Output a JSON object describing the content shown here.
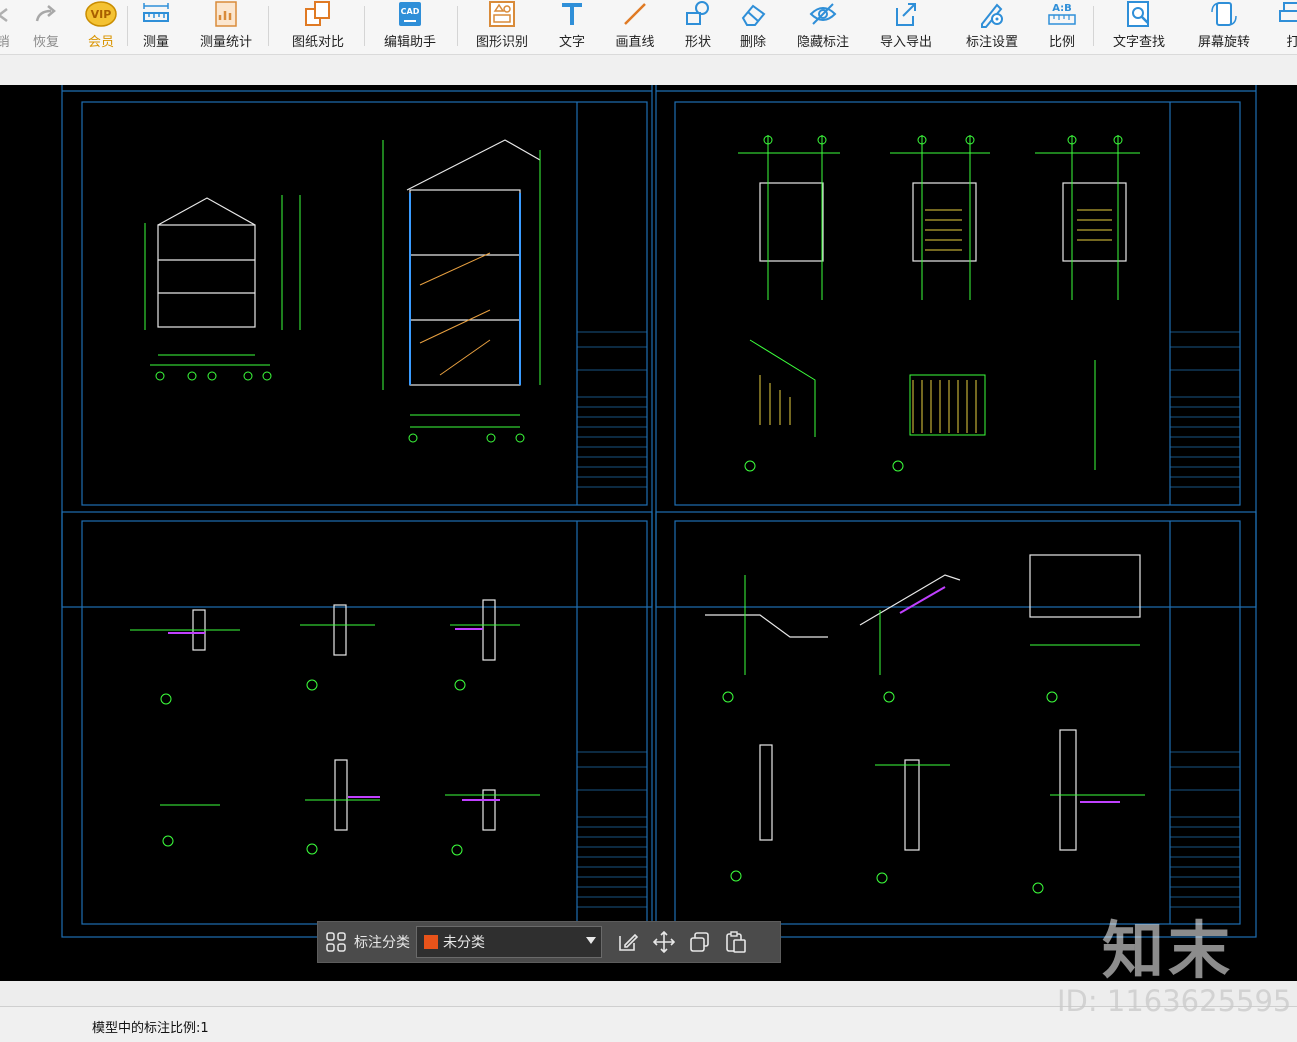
{
  "toolbar": {
    "items": [
      {
        "label": "销",
        "icon": "undo-icon"
      },
      {
        "label": "恢复",
        "icon": "redo-icon"
      },
      {
        "label": "会员",
        "icon": "vip-icon"
      },
      {
        "label": "测量",
        "icon": "measure-icon"
      },
      {
        "label": "测量统计",
        "icon": "measure-stats-icon"
      },
      {
        "label": "图纸对比",
        "icon": "compare-icon"
      },
      {
        "label": "编辑助手",
        "icon": "cad-edit-icon"
      },
      {
        "label": "图形识别",
        "icon": "shape-recognize-icon"
      },
      {
        "label": "文字",
        "icon": "text-icon"
      },
      {
        "label": "画直线",
        "icon": "line-icon"
      },
      {
        "label": "形状",
        "icon": "shape-icon"
      },
      {
        "label": "删除",
        "icon": "eraser-icon"
      },
      {
        "label": "隐藏标注",
        "icon": "hide-eye-icon"
      },
      {
        "label": "导入导出",
        "icon": "import-export-icon"
      },
      {
        "label": "标注设置",
        "icon": "annotation-settings-icon"
      },
      {
        "label": "比例",
        "icon": "scale-icon"
      },
      {
        "label": "文字查找",
        "icon": "text-search-icon"
      },
      {
        "label": "屏幕旋转",
        "icon": "rotate-screen-icon"
      },
      {
        "label": "打",
        "icon": "print-icon"
      }
    ],
    "vip_badge": "VIP",
    "ratio_text": "A:B",
    "cad_text": "CAD"
  },
  "annotation_bar": {
    "label": "标注分类",
    "selected": "未分类",
    "swatch_color": "#e8531a"
  },
  "status": {
    "text": "模型中的标注比例:1"
  },
  "watermark": {
    "brand": "知末",
    "id": "ID: 1163625595"
  },
  "colors": {
    "accent_vip": "#d99400",
    "icon_blue": "#2f8fd8",
    "cad_background": "#000000",
    "cad_frame": "#1f6fb2",
    "cad_line_green": "#3cff3c"
  }
}
